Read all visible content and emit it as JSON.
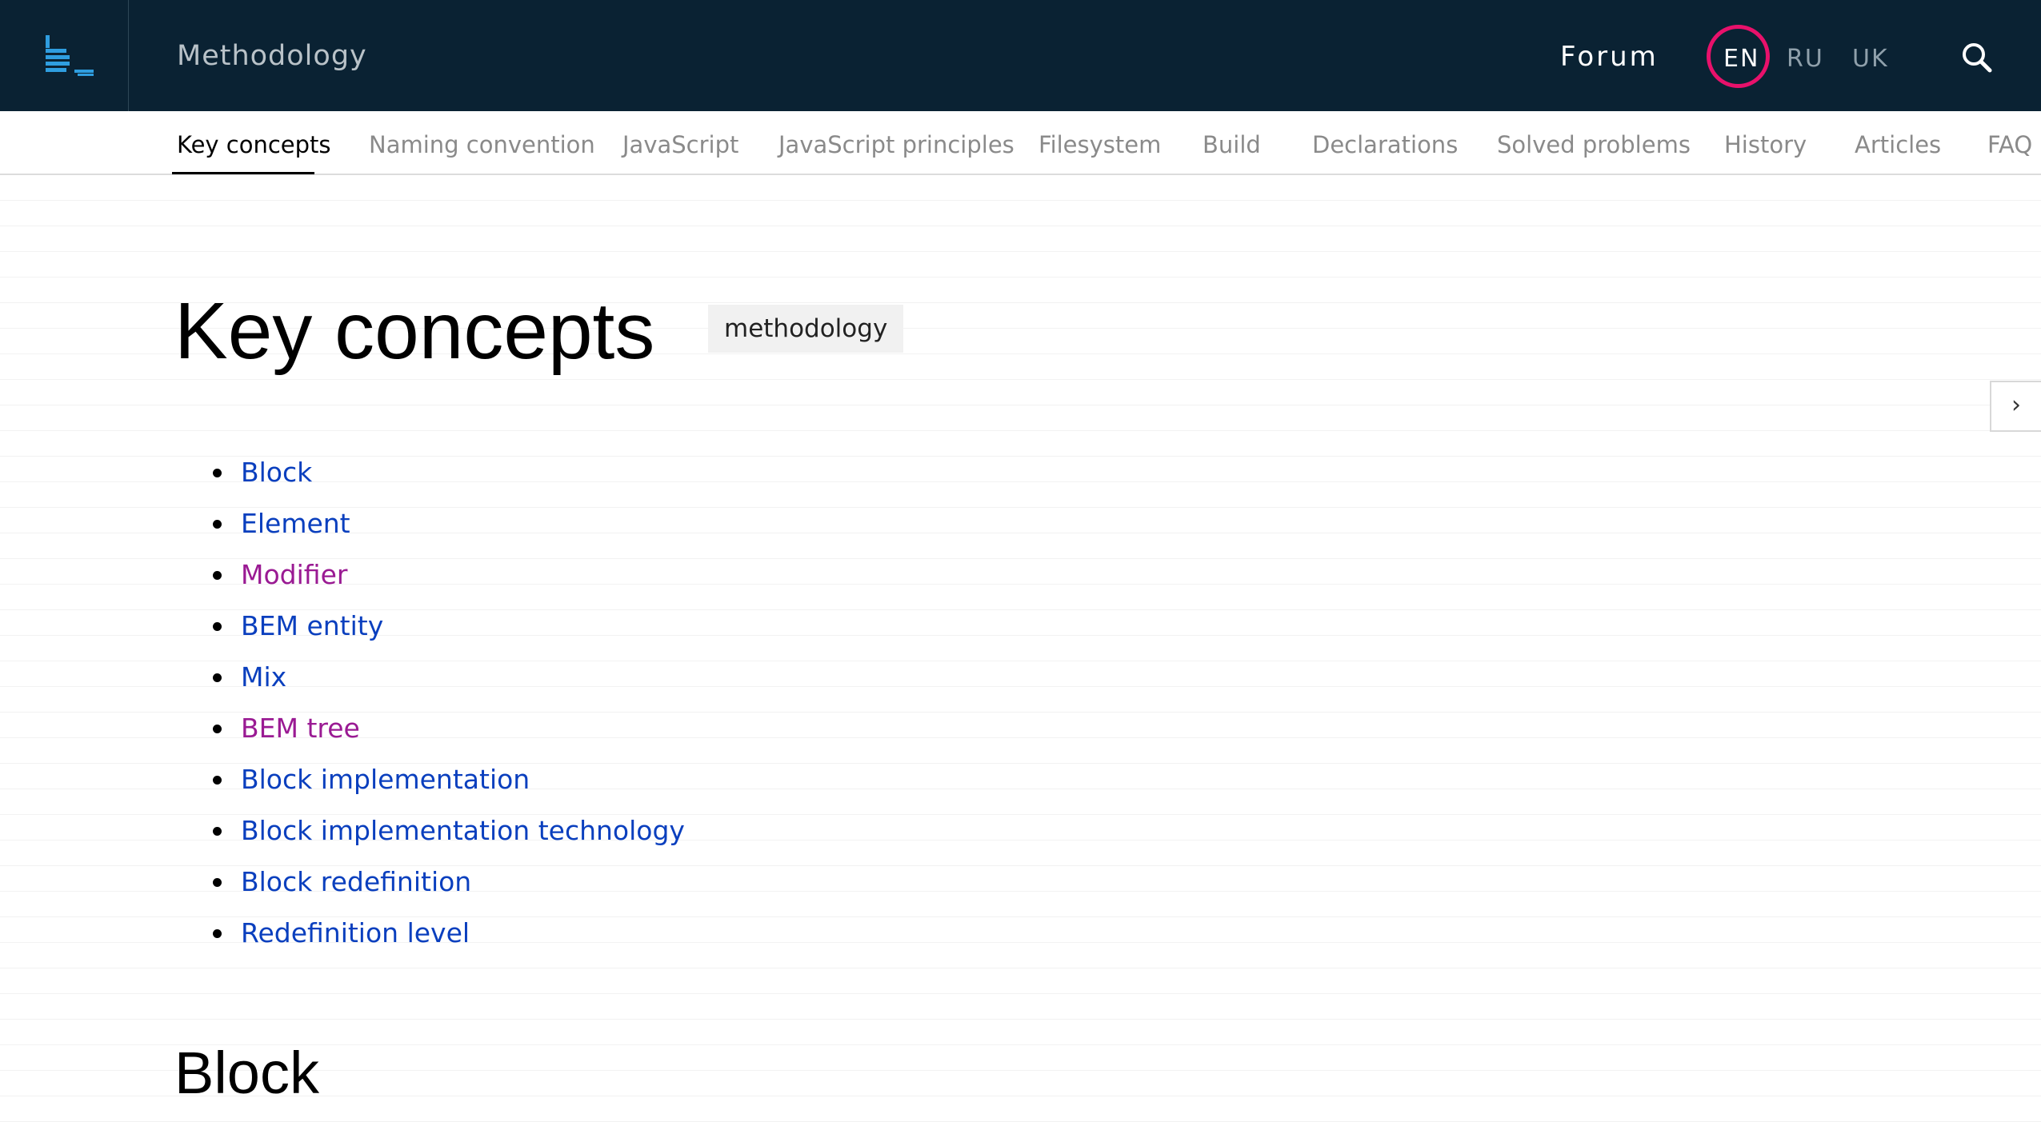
{
  "header": {
    "site_title": "Methodology",
    "forum_label": "Forum",
    "languages": [
      {
        "code": "EN",
        "active": true
      },
      {
        "code": "RU",
        "active": false
      },
      {
        "code": "UK",
        "active": false
      }
    ],
    "logo_icon": "bem-logo-icon",
    "search_icon": "search-icon",
    "colors": {
      "background": "#0a2233",
      "active_ring": "#e8116b"
    }
  },
  "subnav": {
    "tabs": [
      {
        "label": "Key concepts",
        "active": true
      },
      {
        "label": "Naming convention",
        "active": false
      },
      {
        "label": "JavaScript",
        "active": false
      },
      {
        "label": "JavaScript principles",
        "active": false
      },
      {
        "label": "Filesystem",
        "active": false
      },
      {
        "label": "Build",
        "active": false
      },
      {
        "label": "Declarations",
        "active": false
      },
      {
        "label": "Solved problems",
        "active": false
      },
      {
        "label": "History",
        "active": false
      },
      {
        "label": "Articles",
        "active": false
      },
      {
        "label": "FAQ",
        "active": false
      }
    ]
  },
  "main": {
    "title": "Key concepts",
    "tag": "methodology",
    "toc": [
      {
        "label": "Block",
        "visited": false
      },
      {
        "label": "Element",
        "visited": false
      },
      {
        "label": "Modifier",
        "visited": true
      },
      {
        "label": "BEM entity",
        "visited": false
      },
      {
        "label": "Mix",
        "visited": false
      },
      {
        "label": "BEM tree",
        "visited": true
      },
      {
        "label": "Block implementation",
        "visited": false
      },
      {
        "label": "Block implementation technology",
        "visited": false
      },
      {
        "label": "Block redefinition",
        "visited": false
      },
      {
        "label": "Redefinition level",
        "visited": false
      }
    ],
    "section_heading": "Block",
    "sidebar_toggle": "›",
    "colors": {
      "link": "#0a3fbe",
      "visited_link": "#9a1a93"
    }
  }
}
